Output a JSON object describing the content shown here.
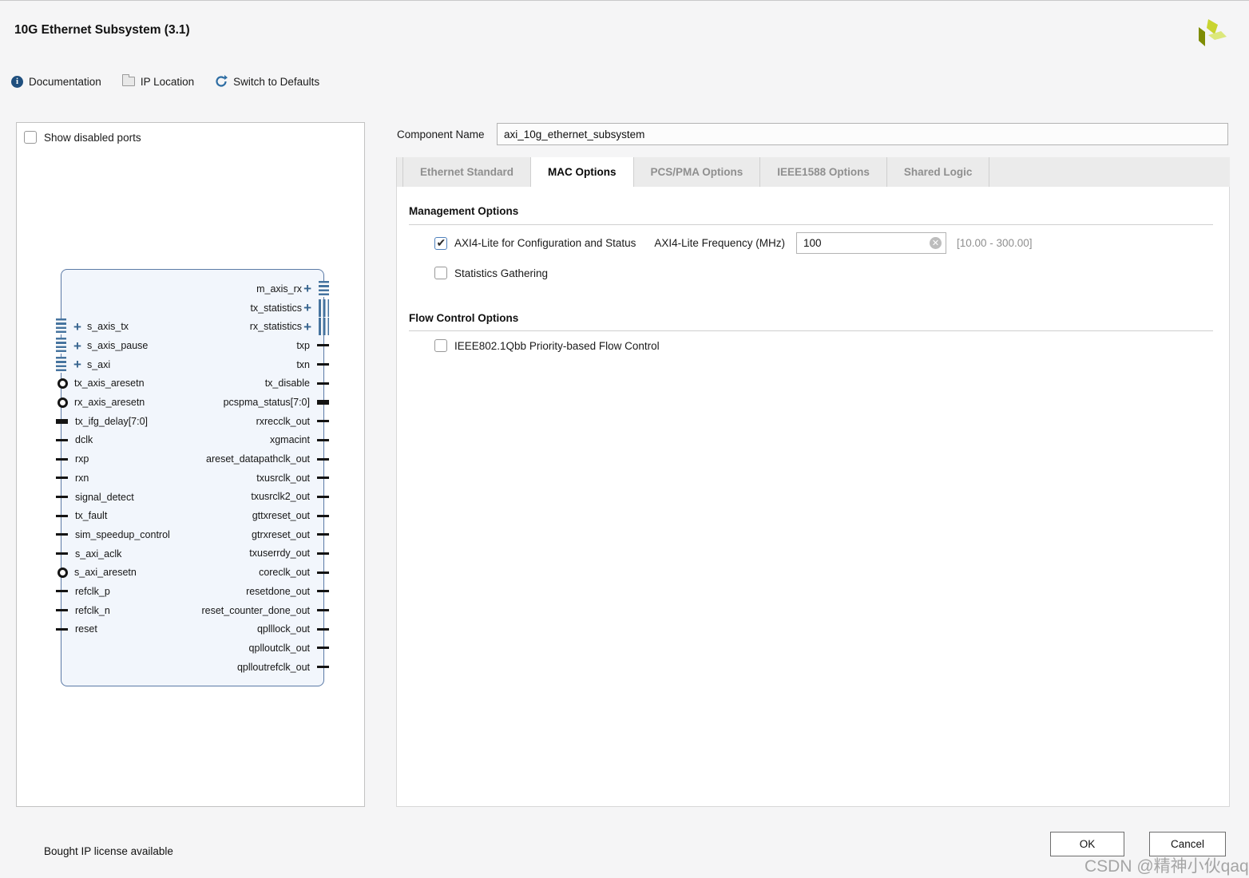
{
  "header": {
    "title": "10G Ethernet Subsystem (3.1)"
  },
  "toolbar": {
    "documentation": "Documentation",
    "ip_location": "IP Location",
    "switch_to_defaults": "Switch to Defaults"
  },
  "left_panel": {
    "show_disabled_ports": "Show disabled ports"
  },
  "block_diagram": {
    "left_ports": [
      {
        "label": "s_axis_tx",
        "type": "intf",
        "icon": "stripes"
      },
      {
        "label": "s_axis_pause",
        "type": "intf",
        "icon": "stripes"
      },
      {
        "label": "s_axi",
        "type": "intf",
        "icon": "stripes"
      },
      {
        "label": "tx_axis_aresetn",
        "type": "neg"
      },
      {
        "label": "rx_axis_aresetn",
        "type": "neg"
      },
      {
        "label": "tx_ifg_delay[7:0]",
        "type": "bus"
      },
      {
        "label": "dclk",
        "type": "wire"
      },
      {
        "label": "rxp",
        "type": "wire"
      },
      {
        "label": "rxn",
        "type": "wire"
      },
      {
        "label": "signal_detect",
        "type": "wire"
      },
      {
        "label": "tx_fault",
        "type": "wire"
      },
      {
        "label": "sim_speedup_control",
        "type": "wire"
      },
      {
        "label": "s_axi_aclk",
        "type": "wire"
      },
      {
        "label": "s_axi_aresetn",
        "type": "neg"
      },
      {
        "label": "refclk_p",
        "type": "wire"
      },
      {
        "label": "refclk_n",
        "type": "wire"
      },
      {
        "label": "reset",
        "type": "wire"
      }
    ],
    "right_ports": [
      {
        "label": "m_axis_rx",
        "type": "intf",
        "icon": "stripes"
      },
      {
        "label": "tx_statistics",
        "type": "intf",
        "icon": "bars"
      },
      {
        "label": "rx_statistics",
        "type": "intf",
        "icon": "bars"
      },
      {
        "label": "txp",
        "type": "wire"
      },
      {
        "label": "txn",
        "type": "wire"
      },
      {
        "label": "tx_disable",
        "type": "wire"
      },
      {
        "label": "pcspma_status[7:0]",
        "type": "bus"
      },
      {
        "label": "rxrecclk_out",
        "type": "wire"
      },
      {
        "label": "xgmacint",
        "type": "wire"
      },
      {
        "label": "areset_datapathclk_out",
        "type": "wire"
      },
      {
        "label": "txusrclk_out",
        "type": "wire"
      },
      {
        "label": "txusrclk2_out",
        "type": "wire"
      },
      {
        "label": "gttxreset_out",
        "type": "wire"
      },
      {
        "label": "gtrxreset_out",
        "type": "wire"
      },
      {
        "label": "txuserrdy_out",
        "type": "wire"
      },
      {
        "label": "coreclk_out",
        "type": "wire"
      },
      {
        "label": "resetdone_out",
        "type": "wire"
      },
      {
        "label": "reset_counter_done_out",
        "type": "wire"
      },
      {
        "label": "qplllock_out",
        "type": "wire"
      },
      {
        "label": "qplloutclk_out",
        "type": "wire"
      },
      {
        "label": "qplloutrefclk_out",
        "type": "wire"
      }
    ]
  },
  "component": {
    "label": "Component Name",
    "value": "axi_10g_ethernet_subsystem"
  },
  "tabs": [
    {
      "label": "Ethernet Standard",
      "active": false
    },
    {
      "label": "MAC Options",
      "active": true
    },
    {
      "label": "PCS/PMA Options",
      "active": false
    },
    {
      "label": "IEEE1588 Options",
      "active": false
    },
    {
      "label": "Shared Logic",
      "active": false
    }
  ],
  "mac_options": {
    "management_heading": "Management Options",
    "axi4_lite_label": "AXI4-Lite for Configuration and Status",
    "axi4_lite_checked": true,
    "frequency_label": "AXI4-Lite Frequency (MHz)",
    "frequency_value": "100",
    "frequency_range": "[10.00 - 300.00]",
    "statistics_label": "Statistics Gathering",
    "statistics_checked": false,
    "flow_heading": "Flow Control Options",
    "qbb_label": "IEEE802.1Qbb Priority-based Flow Control",
    "qbb_checked": false
  },
  "footer": {
    "license_note": "Bought IP license available",
    "ok": "OK",
    "cancel": "Cancel"
  },
  "watermark": "CSDN @精神小伙qaq",
  "icons": {
    "info-icon": "circled-i",
    "folder-icon": "folder",
    "refresh-icon": "circular-arrow",
    "clear-icon": "circled-x",
    "expand-plus-icon": "+",
    "bus-interface-icon": "striped-block",
    "xilinx-logo": "three-green-parallelograms"
  },
  "colors": {
    "accent_blue": "#38658f",
    "block_fill": "#f2f6fc",
    "block_border": "#5b7aa6",
    "logo_bright": "#c9d430",
    "logo_dark": "#7e8c04",
    "logo_light": "#dce87c",
    "tab_inactive_text": "#8f8f8f"
  }
}
